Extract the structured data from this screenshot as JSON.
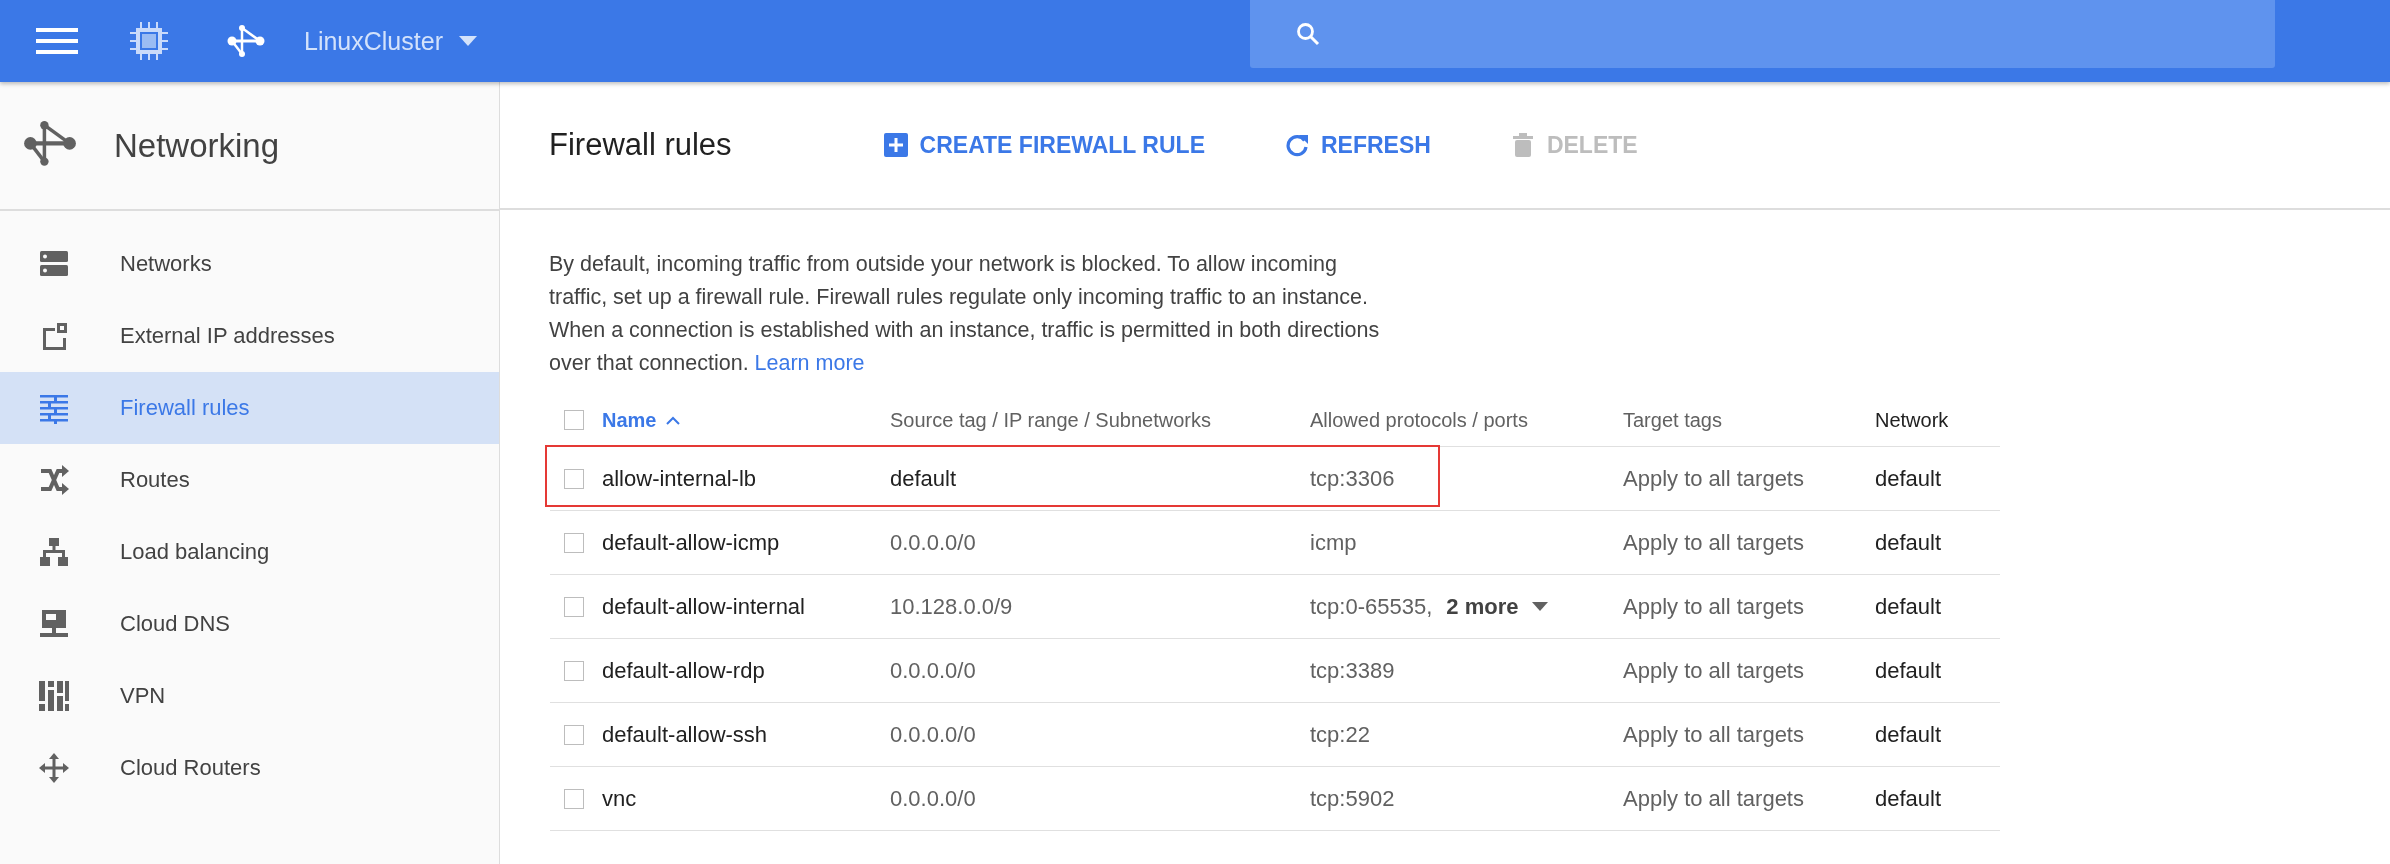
{
  "top_bar": {
    "project": "LinuxCluster"
  },
  "sidebar": {
    "title": "Networking",
    "items": [
      {
        "label": "Networks",
        "kind": "networks",
        "selected": false
      },
      {
        "label": "External IP addresses",
        "kind": "external-ip",
        "selected": false
      },
      {
        "label": "Firewall rules",
        "kind": "firewall",
        "selected": true
      },
      {
        "label": "Routes",
        "kind": "routes",
        "selected": false
      },
      {
        "label": "Load balancing",
        "kind": "load-balancing",
        "selected": false
      },
      {
        "label": "Cloud DNS",
        "kind": "dns",
        "selected": false
      },
      {
        "label": "VPN",
        "kind": "vpn",
        "selected": false
      },
      {
        "label": "Cloud Routers",
        "kind": "routers",
        "selected": false
      }
    ]
  },
  "page": {
    "title": "Firewall rules",
    "actions": [
      {
        "label": "CREATE FIREWALL RULE",
        "kind": "create",
        "disabled": false
      },
      {
        "label": "REFRESH",
        "kind": "refresh",
        "disabled": false
      },
      {
        "label": "DELETE",
        "kind": "delete",
        "disabled": true
      }
    ]
  },
  "description": {
    "text": "By default, incoming traffic from outside your network is blocked. To allow incoming traffic, set up a firewall rule. Firewall rules regulate only incoming traffic to an instance. When a connection is established with an instance, traffic is permitted in both directions over that connection. ",
    "link": "Learn more"
  },
  "table": {
    "select_all": {
      "checked": false
    },
    "columns": [
      {
        "label": "Name",
        "sorted": true
      },
      {
        "label": "Source tag / IP range / Subnetworks",
        "sorted": false
      },
      {
        "label": "Allowed protocols / ports",
        "sorted": false
      },
      {
        "label": "Target tags",
        "sorted": false
      },
      {
        "label": "Network",
        "sorted": false
      }
    ],
    "rows": [
      {
        "checked": false,
        "highlighted": true,
        "name": "allow-internal-lb",
        "source": "default",
        "allowed": "tcp:3306",
        "target": "Apply to all targets",
        "network": "default"
      },
      {
        "checked": false,
        "highlighted": false,
        "name": "default-allow-icmp",
        "source": "0.0.0.0/0",
        "allowed": "icmp",
        "target": "Apply to all targets",
        "network": "default"
      },
      {
        "checked": false,
        "highlighted": false,
        "name": "default-allow-internal",
        "source": "10.128.0.0/9",
        "allowed": "tcp:0-65535,",
        "more": "2 more",
        "target": "Apply to all targets",
        "network": "default"
      },
      {
        "checked": false,
        "highlighted": false,
        "name": "default-allow-rdp",
        "source": "0.0.0.0/0",
        "allowed": "tcp:3389",
        "target": "Apply to all targets",
        "network": "default"
      },
      {
        "checked": false,
        "highlighted": false,
        "name": "default-allow-ssh",
        "source": "0.0.0.0/0",
        "allowed": "tcp:22",
        "target": "Apply to all targets",
        "network": "default"
      },
      {
        "checked": false,
        "highlighted": false,
        "name": "vnc",
        "source": "0.0.0.0/0",
        "allowed": "tcp:5902",
        "target": "Apply to all targets",
        "network": "default"
      }
    ]
  }
}
